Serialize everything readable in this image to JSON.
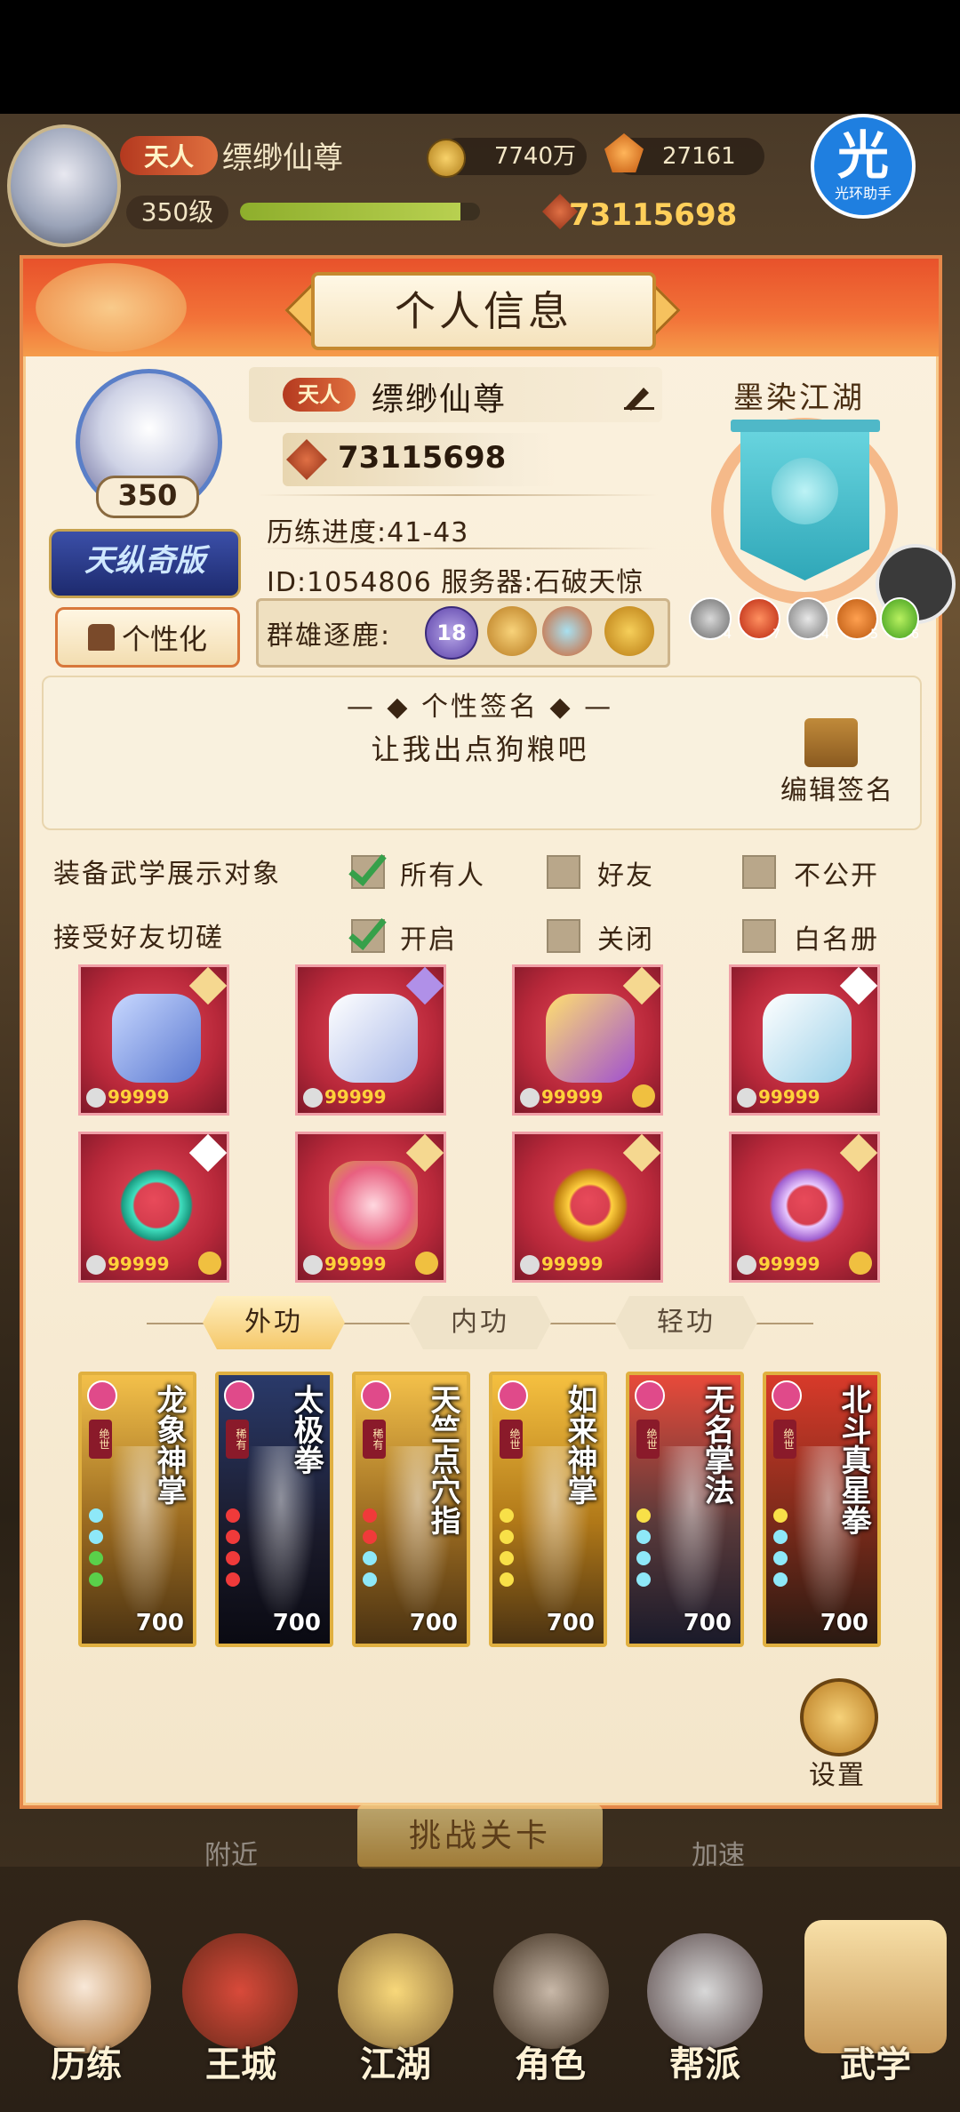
{
  "top_bar": {
    "rank": "天人",
    "name": "缥缈仙尊",
    "coins": "7740万",
    "gems": "27161",
    "level": "350级",
    "xp_fraction": 0.92,
    "power": "73115698"
  },
  "overlay_badge": {
    "glyph": "光",
    "label": "光环助手"
  },
  "modal": {
    "title": "个人信息",
    "avatar_level": "350",
    "title_banner": "天纵奇版",
    "personalize_label": "个性化",
    "rank": "天人",
    "name": "缥缈仙尊",
    "power": "73115698",
    "progress": "历练进度:41-43",
    "id_server": "ID:1054806    服务器:石破天惊",
    "qunxiong_label": "群雄逐鹿:",
    "qunxiong_badge": "18",
    "sect_name": "墨染江湖",
    "sect_badges": [
      "4",
      "7",
      "4",
      "5",
      "6"
    ],
    "signature_title": "个性签名",
    "signature_text": "让我出点狗粮吧",
    "edit_signature": "编辑签名",
    "row1_label": "装备武学展示对象",
    "row1_options": [
      "所有人",
      "好友",
      "不公开"
    ],
    "row2_label": "接受好友切磋",
    "row2_options": [
      "开启",
      "关闭",
      "白名册"
    ],
    "equip_count": "99999",
    "tabs": [
      "外功",
      "内功",
      "轻功"
    ],
    "skills": [
      {
        "name": "龙象神掌",
        "tag": "绝世",
        "value": "700"
      },
      {
        "name": "太极拳",
        "tag": "稀有",
        "value": "700"
      },
      {
        "name": "天竺点穴指",
        "tag": "稀有",
        "value": "700"
      },
      {
        "name": "如来神掌",
        "tag": "绝世",
        "value": "700"
      },
      {
        "name": "无名掌法",
        "tag": "绝世",
        "value": "700"
      },
      {
        "name": "北斗真星拳",
        "tag": "绝世",
        "value": "700"
      }
    ],
    "settings_label": "设置"
  },
  "background": {
    "nearby": "附近",
    "challenge": "挑战关卡",
    "speedup": "加速"
  },
  "nav": [
    "历练",
    "王城",
    "江湖",
    "角色",
    "帮派",
    "武学"
  ],
  "colors": {
    "accent_orange": "#e8522b",
    "check_green": "#36a04a",
    "equip_red": "#b8283a"
  }
}
